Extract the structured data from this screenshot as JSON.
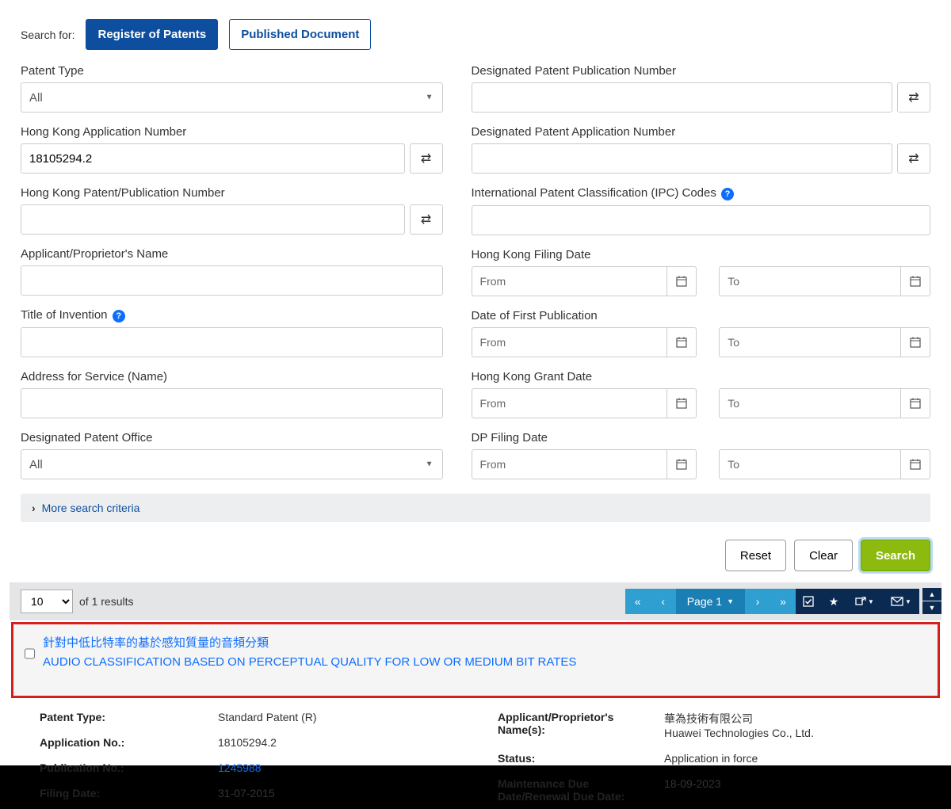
{
  "tabs": {
    "searchFor": "Search for:",
    "register": "Register of Patents",
    "published": "Published Document"
  },
  "fields": {
    "patentType": "Patent Type",
    "patentTypeAll": "All",
    "hkAppNo": "Hong Kong Application Number",
    "hkAppNoVal": "18105294.2",
    "hkPubNo": "Hong Kong Patent/Publication Number",
    "applicantName": "Applicant/Proprietor's Name",
    "titleInvention": "Title of Invention",
    "addressService": "Address for Service (Name)",
    "dpo": "Designated Patent Office",
    "dpoAll": "All",
    "dpPubNo": "Designated Patent Publication Number",
    "dpAppNo": "Designated Patent Application Number",
    "ipc": "International Patent Classification (IPC) Codes",
    "hkFiling": "Hong Kong Filing Date",
    "firstPub": "Date of First Publication",
    "hkGrant": "Hong Kong Grant Date",
    "dpFiling": "DP Filing Date",
    "from": "From",
    "to": "To"
  },
  "more": "More search criteria",
  "actions": {
    "reset": "Reset",
    "clear": "Clear",
    "search": "Search"
  },
  "results": {
    "perPage": "10",
    "ofText": "of 1 results",
    "pageLabel": "Page 1"
  },
  "item": {
    "titleZh": "針對中低比特率的基於感知質量的音頻分類",
    "titleEn": "AUDIO CLASSIFICATION BASED ON PERCEPTUAL QUALITY FOR LOW OR MEDIUM BIT RATES"
  },
  "details": {
    "patentTypeL": "Patent Type:",
    "patentTypeV": "Standard Patent (R)",
    "appNoL": "Application No.:",
    "appNoV": "18105294.2",
    "pubNoL": "Publication No.:",
    "pubNoV": "1245988",
    "filingL": "Filing Date:",
    "filingV": "31-07-2015",
    "applicantL": "Applicant/Proprietor's Name(s):",
    "applicantVZh": "華為技術有限公司",
    "applicantVEn": "Huawei Technologies Co., Ltd.",
    "statusL": "Status:",
    "statusV": "Application in force",
    "maintL": "Maintenance Due Date/Renewal Due Date:",
    "maintV": "18-09-2023"
  }
}
